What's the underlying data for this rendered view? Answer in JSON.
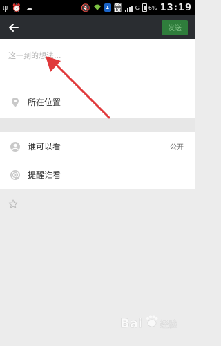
{
  "status_bar": {
    "time": "13:19",
    "battery": "6%",
    "signal_badge_1": "1",
    "network_badge": "3G 1X",
    "g_label": "G",
    "icons": [
      "usb-icon",
      "alarm-icon",
      "weather-icon",
      "mute-icon",
      "wifi-icon",
      "sim-icon",
      "network-icon",
      "signal-icon",
      "battery-icon"
    ]
  },
  "header": {
    "back_icon": "arrow-left-icon",
    "send_label": "发送"
  },
  "compose": {
    "placeholder": "这一刻的想法..."
  },
  "location": {
    "icon": "location-pin-icon",
    "label": "所在位置"
  },
  "visibility": {
    "icon": "person-icon",
    "label": "谁可以看",
    "value": "公开"
  },
  "remind": {
    "icon": "at-icon",
    "label": "提醒谁看"
  },
  "lower": {
    "icon": "star-icon"
  },
  "overlay": {
    "arrow_color": "#e0393b",
    "watermark_text": "Baidu经验"
  },
  "colors": {
    "header_bg": "#2a2d31",
    "send_button_bg": "#2f7d3c",
    "page_bg": "#ececec"
  }
}
